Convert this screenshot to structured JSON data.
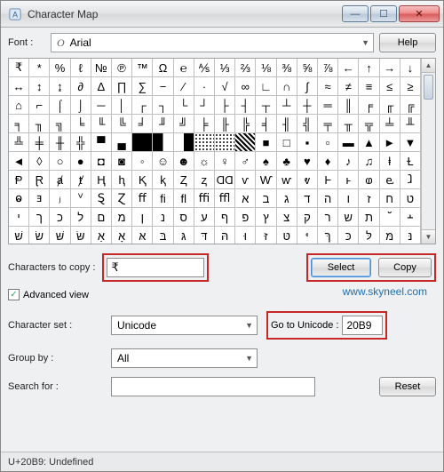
{
  "window": {
    "title": "Character Map"
  },
  "font": {
    "label": "Font :",
    "value": "Arial"
  },
  "help_label": "Help",
  "grid": {
    "rows": [
      [
        "₹",
        "*",
        "%",
        "ℓ",
        "№",
        "℗",
        "™",
        "Ω",
        "℮",
        "⅍",
        "⅓",
        "⅔",
        "⅛",
        "⅜",
        "⅝",
        "⅞",
        "←",
        "↑",
        "→",
        "↓"
      ],
      [
        "↔",
        "↕",
        "↨",
        "∂",
        "Δ",
        "∏",
        "∑",
        "−",
        "∕",
        "∙",
        "√",
        "∞",
        "∟",
        "∩",
        "∫",
        "≈",
        "≠",
        "≡",
        "≤",
        "≥"
      ],
      [
        "⌂",
        "⌐",
        "⌠",
        "⌡",
        "─",
        "│",
        "┌",
        "┐",
        "└",
        "┘",
        "├",
        "┤",
        "┬",
        "┴",
        "┼",
        "═",
        "║",
        "╒",
        "╓",
        "╔"
      ],
      [
        "╕",
        "╖",
        "╗",
        "╘",
        "╙",
        "╚",
        "╛",
        "╜",
        "╝",
        "╞",
        "╟",
        "╠",
        "╡",
        "╢",
        "╣",
        "╤",
        "╥",
        "╦",
        "╧",
        "╨"
      ],
      [
        "╩",
        "╪",
        "╫",
        "╬",
        "▀",
        "▄",
        "█",
        "▌",
        "▐",
        "░",
        "▒",
        "▓",
        "■",
        "□",
        "▪",
        "▫",
        "▬",
        "▲",
        "►",
        "▼"
      ],
      [
        "◄",
        "◊",
        "○",
        "●",
        "◘",
        "◙",
        "◦",
        "☺",
        "☻",
        "☼",
        "♀",
        "♂",
        "♠",
        "♣",
        "♥",
        "♦",
        "♪",
        "♫",
        "ⱡ",
        "Ɫ"
      ],
      [
        "Ᵽ",
        "Ɽ",
        "ⱥ",
        "ⱦ",
        "Ⱨ",
        "ⱨ",
        "Ⱪ",
        "ⱪ",
        "Ⱬ",
        "ⱬ",
        "ⱭⱭ",
        "ⱱ",
        "Ⱳ",
        "ⱳ",
        "ⱴ",
        "Ⱶ",
        "ⱶ",
        "ⱷ",
        "ⱸ",
        "ⱹ"
      ],
      [
        "ⱺ",
        "ⱻ",
        "ⱼ",
        "ⱽ",
        "Ȿ",
        "Ɀ",
        "ﬀ",
        "ﬁ",
        "ﬂ",
        "ﬃ",
        "ﬄ",
        "א",
        "ב",
        "ג",
        "ד",
        "ה",
        "ו",
        "ז",
        "ח",
        "ט"
      ],
      [
        "י",
        "ך",
        "כ",
        "ל",
        "ם",
        "מ",
        "ן",
        "נ",
        "ס",
        "ע",
        "ף",
        "פ",
        "ץ",
        "צ",
        "ק",
        "ר",
        "ש",
        "ת",
        "ﬞ",
        "﬩"
      ],
      [
        "שׁ",
        "שׂ",
        "שּׁ",
        "שּׂ",
        "אַ",
        "אָ",
        "אּ",
        "בּ",
        "גּ",
        "דּ",
        "הּ",
        "וּ",
        "זּ",
        "טּ",
        "יּ",
        "ךּ",
        "כּ",
        "לּ",
        "מּ",
        "נּ"
      ]
    ]
  },
  "chars_to_copy": {
    "label": "Characters to copy :",
    "value": "₹"
  },
  "select_label": "Select",
  "copy_label": "Copy",
  "adv_view": {
    "label": "Advanced view",
    "checked": true
  },
  "charset": {
    "label": "Character set :",
    "value": "Unicode"
  },
  "goto": {
    "label": "Go to Unicode :",
    "value": "20B9"
  },
  "group": {
    "label": "Group by :",
    "value": "All"
  },
  "search": {
    "label": "Search for :",
    "value": ""
  },
  "reset_label": "Reset",
  "status": "U+20B9: Undefined",
  "watermark": "www.skyneel.com"
}
